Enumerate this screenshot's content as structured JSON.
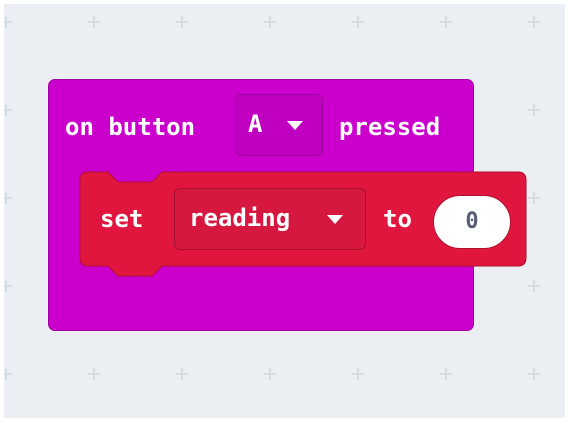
{
  "event_block": {
    "prefix": "on button",
    "button_choice": "A",
    "suffix": "pressed",
    "color": "#cc00cc"
  },
  "set_block": {
    "keyword": "set",
    "variable": "reading",
    "connector": "to",
    "value": "0",
    "color": "#e0163f"
  },
  "icons": {
    "dropdown": "caret-down-icon",
    "grid": "plus-grid-mark"
  }
}
